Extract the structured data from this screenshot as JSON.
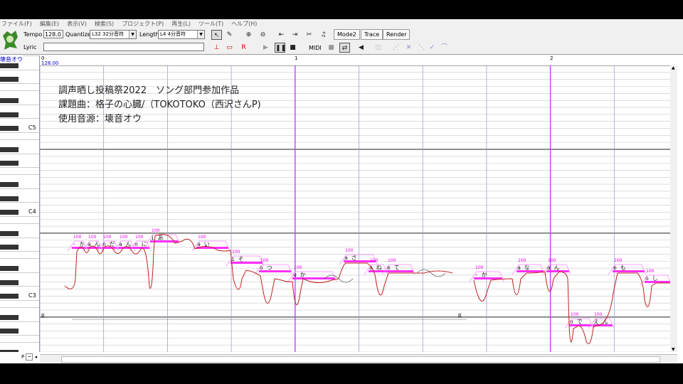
{
  "menu": [
    "ファイル(F)",
    "編集(E)",
    "表示(V)",
    "検索(S)",
    "プロジェクト(P)",
    "再生(L)",
    "ツール(T)",
    "ヘルプ(H)"
  ],
  "toolbar": {
    "tempo_label": "Tempo",
    "tempo_value": "128.0",
    "quantize_label": "Quantize",
    "quantize_value": "L32 32分音符",
    "length_label": "Length",
    "length_value": "L4  4分音符",
    "lyric_label": "Lyric",
    "lyric_value": "",
    "mode_button": "Mode2",
    "trace_button": "Trace",
    "render_button": "Render",
    "midi_label": "MIDI"
  },
  "singer": "壊音オウ",
  "ruler": {
    "tempo_marker": "128.00",
    "measures": [
      "0",
      "1",
      "2"
    ]
  },
  "keyboard": {
    "octave_labels": [
      "C5",
      "C4",
      "C3"
    ]
  },
  "overlay_text": [
    "調声晒し投稿祭2022　ソング部門参加作品",
    "課題曲：格子の心臓/（TOKOTOKO（西沢さんP)",
    "使用音源：壊音オウ"
  ],
  "rest_label": "R",
  "notes": [
    {
      "lyric": "- か",
      "vel": "100"
    },
    {
      "lyric": "a ん",
      "vel": "100"
    },
    {
      "lyric": "n だ",
      "vel": "100"
    },
    {
      "lyric": "a ん",
      "vel": "100"
    },
    {
      "lyric": "n に",
      "vel": "100"
    },
    {
      "lyric": "i あ",
      "vel": "100"
    },
    {
      "lyric": "a い",
      "vel": "100"
    },
    {
      "lyric": "i そ",
      "vel": "100"
    },
    {
      "lyric": "o つ",
      "vel": "100"
    },
    {
      "lyric": "u か",
      "vel": "100"
    },
    {
      "lyric": "a さ",
      "vel": "100"
    },
    {
      "lyric": "a ね",
      "vel": "100"
    },
    {
      "lyric": "e て",
      "vel": "100"
    },
    {
      "lyric": "- か",
      "vel": "100"
    },
    {
      "lyric": "a な",
      "vel": "100"
    },
    {
      "lyric": "a ん",
      "vel": "100"
    },
    {
      "lyric": "n で",
      "vel": "100"
    },
    {
      "lyric": "え ん",
      "vel": "100"
    },
    {
      "lyric": "e も",
      "vel": "100"
    },
    {
      "lyric": "o し",
      "vel": "100"
    }
  ],
  "pit_label": "P"
}
